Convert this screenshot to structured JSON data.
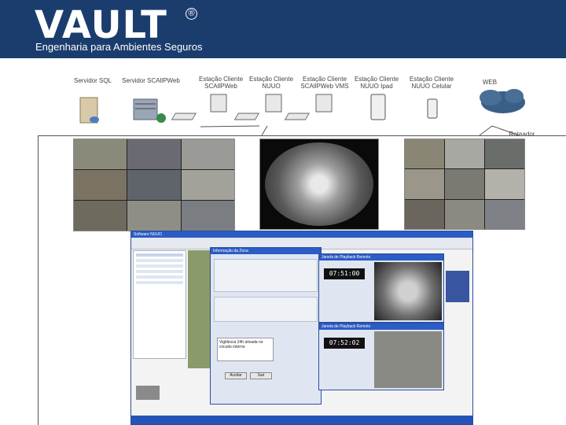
{
  "brand": {
    "logo": "VAULT",
    "registered": "®",
    "tagline": "Engenharia para Ambientes Seguros",
    "bar_color": "#1b3d6e"
  },
  "topology": {
    "nodes": [
      {
        "label1": "Servidor SQL",
        "label2": ""
      },
      {
        "label1": "Servidor SCAllPWeb",
        "label2": ""
      },
      {
        "label1": "Estação Cliente",
        "label2": "SCAllPWeb"
      },
      {
        "label1": "Estação Cliente",
        "label2": "NUUO"
      },
      {
        "label1": "Estação Cliente",
        "label2": "SCAllPWeb VMS"
      },
      {
        "label1": "Estação Cliente",
        "label2": "NUUO Ipad"
      },
      {
        "label1": "Estação Cliente",
        "label2": "NUUO Celular"
      },
      {
        "label1": "WEB",
        "label2": ""
      },
      {
        "label1": "Roteador",
        "label2": ""
      }
    ]
  },
  "app": {
    "title": "Software NUUO",
    "dialog_title": "Informação da Zona",
    "playback1_title": "Janela de Playback Remoto",
    "playback2_title": "Janela de Playback Remoto",
    "time1": "07:51:00",
    "time2": "07:52:02",
    "buttons": {
      "ok": "Aceitar",
      "cancel": "Sair"
    },
    "note": "Vigilância 24h ativada no circuito interno"
  }
}
